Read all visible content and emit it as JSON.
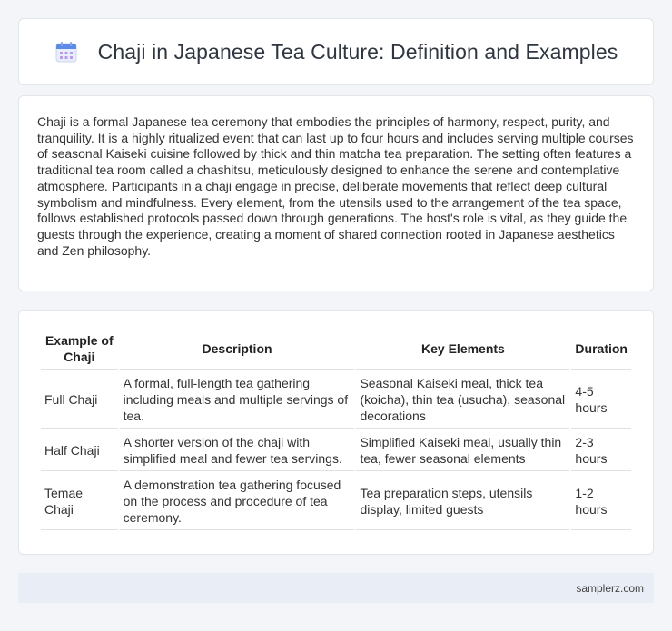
{
  "header": {
    "icon": "calendar-icon",
    "title": "Chaji in Japanese Tea Culture: Definition and Examples"
  },
  "description": "Chaji is a formal Japanese tea ceremony that embodies the principles of harmony, respect, purity, and tranquility. It is a highly ritualized event that can last up to four hours and includes serving multiple courses of seasonal Kaiseki cuisine followed by thick and thin matcha tea preparation. The setting often features a traditional tea room called a chashitsu, meticulously designed to enhance the serene and contemplative atmosphere. Participants in a chaji engage in precise, deliberate movements that reflect deep cultural symbolism and mindfulness. Every element, from the utensils used to the arrangement of the tea space, follows established protocols passed down through generations. The host's role is vital, as they guide the guests through the experience, creating a moment of shared connection rooted in Japanese aesthetics and Zen philosophy.",
  "table": {
    "headers": [
      "Example of Chaji",
      "Description",
      "Key Elements",
      "Duration"
    ],
    "rows": [
      [
        "Full Chaji",
        "A formal, full-length tea gathering including meals and multiple servings of tea.",
        "Seasonal Kaiseki meal, thick tea (koicha), thin tea (usucha), seasonal decorations",
        "4-5 hours"
      ],
      [
        "Half Chaji",
        "A shorter version of the chaji with simplified meal and fewer tea servings.",
        "Simplified Kaiseki meal, usually thin tea, fewer seasonal elements",
        "2-3 hours"
      ],
      [
        "Temae Chaji",
        "A demonstration tea gathering focused on the process and procedure of tea ceremony.",
        "Tea preparation steps, utensils display, limited guests",
        "1-2 hours"
      ]
    ]
  },
  "footer": {
    "site": "samplerz.com"
  },
  "colors": {
    "background": "#f3f5f9",
    "card": "#ffffff",
    "footer_bg": "#e8edf6",
    "icon_accent": "#4a7de0"
  }
}
